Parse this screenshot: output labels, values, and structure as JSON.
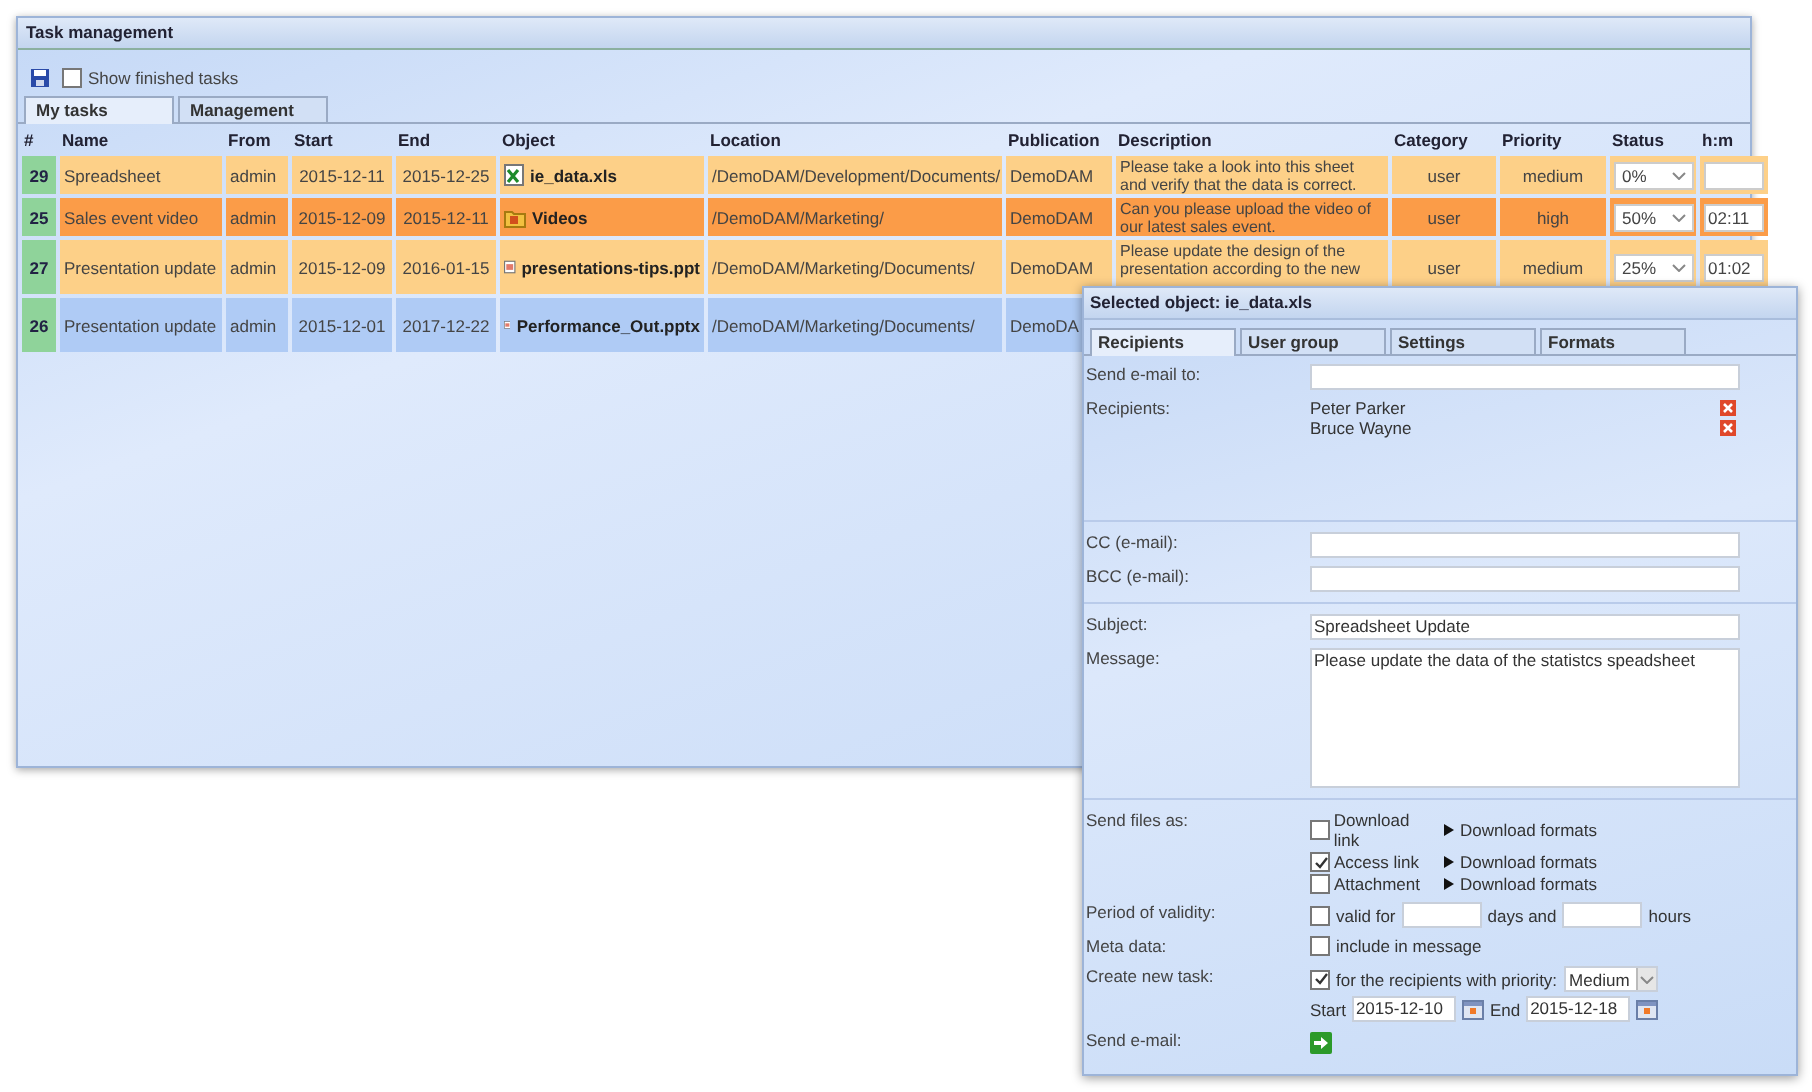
{
  "window": {
    "title": "Task management"
  },
  "toolbar": {
    "show_finished": {
      "label": "Show finished tasks",
      "checked": false
    }
  },
  "tabs": [
    {
      "label": "My tasks",
      "selected": true
    },
    {
      "label": "Management",
      "selected": false
    }
  ],
  "table": {
    "columns": [
      "#",
      "Name",
      "From",
      "Start",
      "End",
      "Object",
      "Location",
      "Publication",
      "Description",
      "Category",
      "Priority",
      "Status",
      "h:m"
    ],
    "rows": [
      {
        "num": "29",
        "name": "Spreadsheet",
        "from": "admin",
        "start": "2015-12-11",
        "end": "2015-12-25",
        "object": "ie_data.xls",
        "kind": "excel",
        "location": "/DemoDAM/Development/Documents/",
        "publication": "DemoDAM",
        "description": "Please take a look into this sheet and verify that the data is correct.",
        "category": "user",
        "priority": "medium",
        "status": "0%",
        "hm": "",
        "color": "#fdd088"
      },
      {
        "num": "25",
        "name": "Sales event video",
        "from": "admin",
        "start": "2015-12-09",
        "end": "2015-12-11",
        "object": "Videos",
        "kind": "folder",
        "location": "/DemoDAM/Marketing/",
        "publication": "DemoDAM",
        "description": "Can you please upload the video of our latest sales event.",
        "category": "user",
        "priority": "high",
        "status": "50%",
        "hm": "02:11",
        "color": "#fb9c48"
      },
      {
        "num": "27",
        "name": "Presentation update",
        "from": "admin",
        "start": "2015-12-09",
        "end": "2016-01-15",
        "object": "presentations-tips.ppt",
        "kind": "powerpoint",
        "location": "/DemoDAM/Marketing/Documents/",
        "publication": "DemoDAM",
        "description": "Please update the design of the presentation according to the new",
        "category": "user",
        "priority": "medium",
        "status": "25%",
        "hm": "01:02",
        "color": "#fdd088"
      },
      {
        "num": "26",
        "name": "Presentation update",
        "from": "admin",
        "start": "2015-12-01",
        "end": "2017-12-22",
        "object": "Performance_Out.pptx",
        "kind": "powerpoint",
        "location": "/DemoDAM/Marketing/Documents/",
        "publication": "DemoDA",
        "color": "#afcbf5"
      }
    ]
  },
  "dialog": {
    "title": "Selected object: ie_data.xls",
    "tabs": [
      {
        "label": "Recipients",
        "selected": true
      },
      {
        "label": "User group",
        "selected": false
      },
      {
        "label": "Settings",
        "selected": false
      },
      {
        "label": "Formats",
        "selected": false
      }
    ],
    "send_email_to": {
      "label": "Send e-mail to:"
    },
    "recipients": {
      "label": "Recipients:",
      "names": [
        "Peter Parker",
        "Bruce Wayne"
      ]
    },
    "cc": {
      "label": "CC (e-mail):"
    },
    "bcc": {
      "label": "BCC (e-mail):"
    },
    "subject": {
      "label": "Subject:",
      "value": "Spreadsheet Update"
    },
    "message": {
      "label": "Message:",
      "value": "Please update the data of the statistcs speadsheet"
    },
    "send_files": {
      "label": "Send files as:",
      "options": [
        {
          "label": "Download link",
          "checked": false,
          "link": "Download formats"
        },
        {
          "label": "Access link",
          "checked": true,
          "link": "Download formats"
        },
        {
          "label": "Attachment",
          "checked": false,
          "link": "Download formats"
        }
      ]
    },
    "validity": {
      "label": "Period of validity:",
      "checked": false,
      "prefix": "valid for",
      "middle": "days and",
      "suffix": "hours"
    },
    "meta": {
      "label": "Meta data:",
      "checked": false,
      "text": "include in message"
    },
    "create_task": {
      "label": "Create new task:",
      "checked": true,
      "text": "for the recipients with priority:",
      "priority": "Medium",
      "start_label": "Start",
      "start": "2015-12-10",
      "end_label": "End",
      "end": "2015-12-18"
    },
    "send": {
      "label": "Send e-mail:"
    }
  }
}
